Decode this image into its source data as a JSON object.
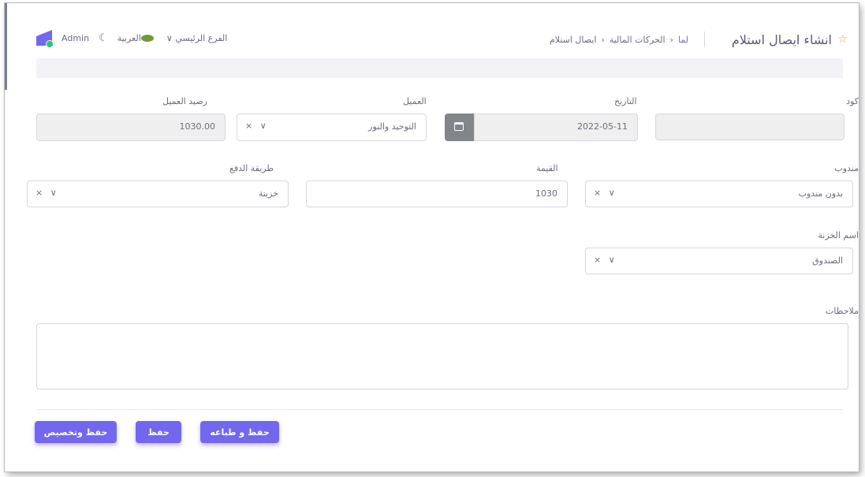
{
  "header": {
    "page_title": "انشاء ايصال استلام",
    "breadcrumb": [
      "لما",
      "الحركات المالية",
      "ايصال استلام"
    ],
    "branch": "الفرع الرئيسي",
    "language": "العربية",
    "user": "Admin"
  },
  "form": {
    "code": {
      "label": "كود",
      "value": ""
    },
    "date": {
      "label": "التاريخ",
      "value": "2022-05-11"
    },
    "client": {
      "label": "العميل",
      "value": "التوحيد والنور"
    },
    "client_balance": {
      "label": "رصيد العميل",
      "value": "1030.00"
    },
    "delegate": {
      "label": "مندوب",
      "value": "بدون مندوب"
    },
    "amount": {
      "label": "القيمة",
      "value": "1030"
    },
    "payment_method": {
      "label": "طريقة الدفع",
      "value": "خزينة"
    },
    "treasury": {
      "label": "اسم الخزنة",
      "value": "الصندوق"
    },
    "notes": {
      "label": "ملاحظات",
      "value": ""
    }
  },
  "buttons": {
    "save_print": "حفظ و طباعه",
    "save": "حفظ",
    "save_allocate": "حفظ وتخصيص"
  },
  "icons": {
    "select_controls": "× ∨",
    "title_icon": "tag-icon",
    "calendar": "calendar-icon",
    "moon": "moon-icon"
  },
  "colors": {
    "primary": "#7367f0",
    "success": "#28c76f",
    "disabled_bg": "#efefef",
    "calendar_btn": "#82868b"
  }
}
